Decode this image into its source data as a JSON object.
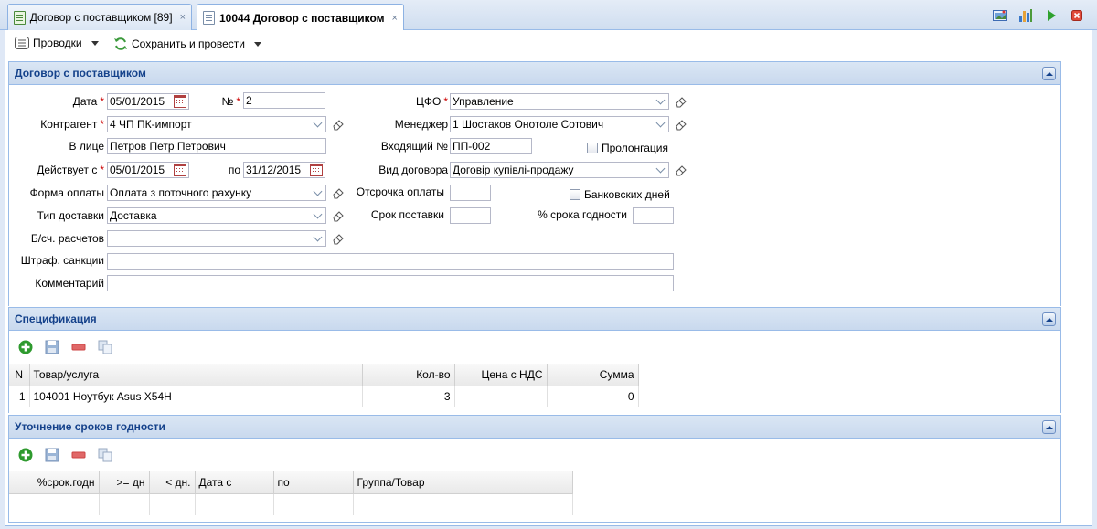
{
  "tabs": [
    {
      "label": "Договор с поставщиком [89]",
      "close": "×",
      "active": false
    },
    {
      "label": "10044 Договор с поставщиком",
      "close": "×",
      "active": true
    }
  ],
  "toolbar": {
    "postings_label": "Проводки",
    "save_post_label": "Сохранить и провести"
  },
  "contract_panel": {
    "title": "Договор с поставщиком",
    "required_mark": "*",
    "date_label": "Дата",
    "date_value": "05/01/2015",
    "number_label": "№",
    "number_value": "2",
    "cfo_label": "ЦФО",
    "cfo_value": "Управление",
    "counterparty_label": "Контрагент",
    "counterparty_value": "4 ЧП ПК-импорт",
    "manager_label": "Менеджер",
    "manager_value": "1 Шостаков Онотоле Сотович",
    "in_person_label": "В лице",
    "in_person_value": "Петров Петр Петрович",
    "incoming_label": "Входящий №",
    "incoming_value": "ПП-002",
    "prolongation_label": "Пролонгация",
    "valid_from_label": "Действует с",
    "valid_from_value": "05/01/2015",
    "valid_to_label": "по",
    "valid_to_value": "31/12/2015",
    "contract_type_label": "Вид договора",
    "contract_type_value": "Договір купівлі-продажу",
    "payment_form_label": "Форма оплаты",
    "payment_form_value": "Оплата з поточного рахунку",
    "payment_delay_label": "Отсрочка оплаты",
    "payment_delay_value": "",
    "bank_days_label": "Банковских дней",
    "delivery_type_label": "Тип доставки",
    "delivery_type_value": "Доставка",
    "delivery_term_label": "Срок поставки",
    "delivery_term_value": "",
    "shelf_life_label": "% срока годности",
    "shelf_life_value": "",
    "settlement_account_label": "Б/сч. расчетов",
    "settlement_account_value": "",
    "penalties_label": "Штраф. санкции",
    "penalties_value": "",
    "comment_label": "Комментарий",
    "comment_value": ""
  },
  "spec_panel": {
    "title": "Спецификация",
    "columns": [
      "N",
      "Товар/услуга",
      "Кол-во",
      "Цена с НДС",
      "Сумма"
    ],
    "rows": [
      {
        "n": "1",
        "item": "104001 Ноутбук Asus X54H",
        "qty": "3",
        "price": "",
        "sum": "0"
      }
    ]
  },
  "shelf_panel": {
    "title": "Уточнение сроков годности",
    "columns": [
      "%срок.годн",
      ">= дн",
      "< дн.",
      "Дата с",
      "по",
      "Группа/Товар"
    ]
  },
  "colors": {
    "header_text": "#15428b",
    "border": "#99bbe8",
    "required": "#cc0000"
  }
}
